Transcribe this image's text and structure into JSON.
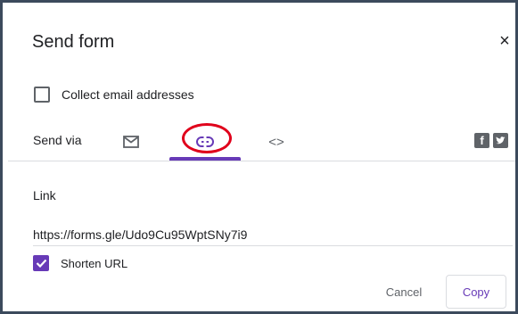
{
  "dialog": {
    "title": "Send form",
    "close_glyph": "×"
  },
  "collect": {
    "label": "Collect email addresses",
    "checked": false
  },
  "send_via": {
    "label": "Send via",
    "tabs": [
      {
        "icon": "mail-icon",
        "active": false
      },
      {
        "icon": "link-icon",
        "active": true
      },
      {
        "icon": "embed-icon",
        "glyph": "<>",
        "active": false
      }
    ],
    "accent_color": "#673ab7",
    "highlight_color": "#e0001b"
  },
  "social": [
    {
      "icon": "facebook-icon",
      "glyph": "f"
    },
    {
      "icon": "twitter-icon"
    }
  ],
  "link": {
    "heading": "Link",
    "url": "https://forms.gle/Udo9Cu95WptSNy7i9"
  },
  "shorten": {
    "label": "Shorten URL",
    "checked": true
  },
  "actions": {
    "cancel_label": "Cancel",
    "copy_label": "Copy"
  }
}
